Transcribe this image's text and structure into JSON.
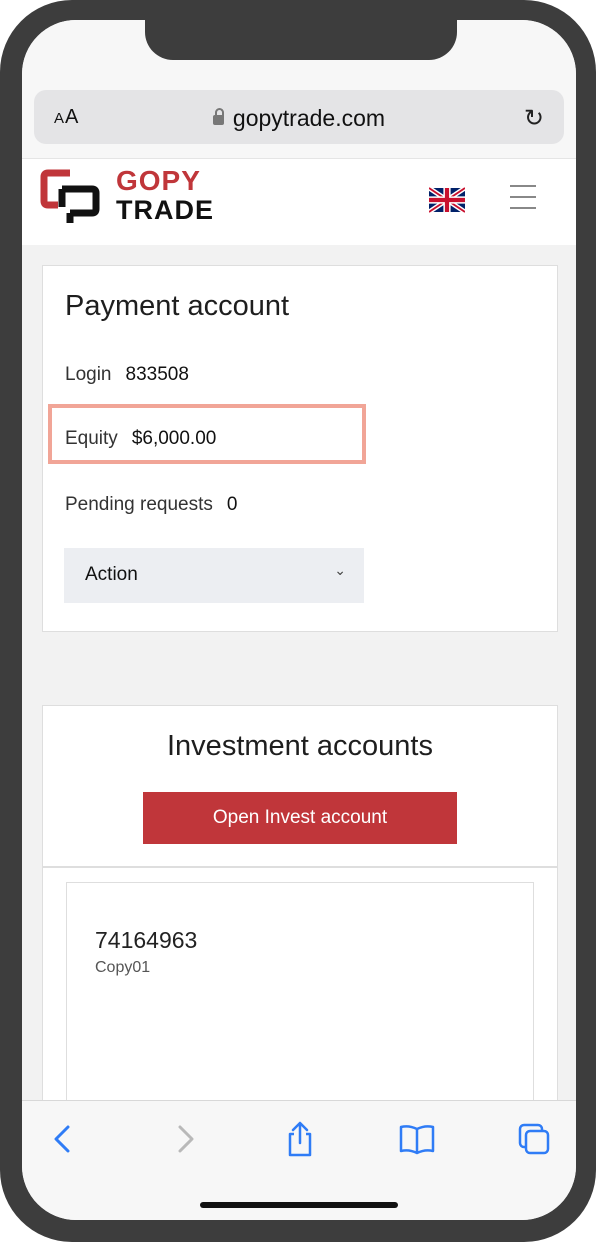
{
  "browser": {
    "text_size_label_small": "A",
    "text_size_label_large": "A",
    "url": "gopytrade.com"
  },
  "site": {
    "logo_line1": "GOPY",
    "logo_line2": "TRADE"
  },
  "payment_account": {
    "title": "Payment account",
    "login_label": "Login",
    "login_value": "833508",
    "equity_label": "Equity",
    "equity_value": "$6,000.00",
    "pending_label": "Pending requests",
    "pending_value": "0",
    "action_label": "Action"
  },
  "investment_accounts": {
    "title": "Investment accounts",
    "open_button_label": "Open Invest account",
    "accounts": [
      {
        "number": "74164963",
        "name": "Copy01"
      }
    ]
  },
  "colors": {
    "brand_red": "#c0363a",
    "highlight": "#f1a597",
    "ios_blue": "#2f7cf6"
  }
}
